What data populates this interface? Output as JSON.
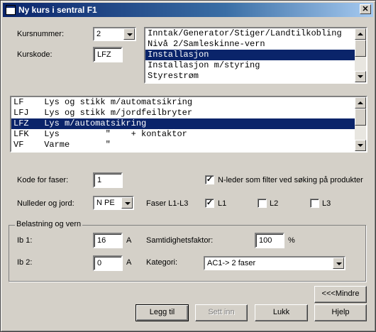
{
  "window": {
    "title": "Ny kurs i sentral  F1"
  },
  "kursnummer": {
    "label": "Kursnummer:",
    "value": "2"
  },
  "kurskode": {
    "label": "Kurskode:",
    "value": "LFZ"
  },
  "category_list": {
    "items": [
      "Inntak/Generator/Stiger/Landtilkobling",
      "Nivå 2/Samleskinne-vern",
      "Installasjon",
      "Installasjon m/styring",
      "Styrestrøm"
    ],
    "selected_index": 2
  },
  "code_list": {
    "items": [
      "LF    Lys og stikk m/automatsikring",
      "LFJ   Lys og stikk m/jordfeilbryter",
      "LFZ   Lys m/automatsikring",
      "LFK   Lys         \"    + kontaktor",
      "VF    Varme       \""
    ],
    "selected_index": 2
  },
  "kode_faser": {
    "label": "Kode for faser:",
    "value": "1"
  },
  "nleder_filter": {
    "label": "N-leder som filter ved søking på produkter",
    "checked": true
  },
  "nulleder": {
    "label": "Nulleder og jord:",
    "value": "N PE"
  },
  "faser": {
    "label": "Faser L1-L3",
    "l1": {
      "label": "L1",
      "checked": true
    },
    "l2": {
      "label": "L2",
      "checked": false
    },
    "l3": {
      "label": "L3",
      "checked": false
    }
  },
  "belastning": {
    "legend": "Belastning og vern",
    "ib1": {
      "label": "Ib 1:",
      "value": "16",
      "unit": "A"
    },
    "ib2": {
      "label": "Ib 2:",
      "value": "0",
      "unit": "A"
    },
    "samtidighet": {
      "label": "Samtidighetsfaktor:",
      "value": "100",
      "unit": "%"
    },
    "kategori": {
      "label": "Kategori:",
      "value": "AC1-> 2 faser"
    }
  },
  "buttons": {
    "mindre": "<<<Mindre",
    "legg_til": "Legg til",
    "sett_inn": "Sett inn",
    "lukk": "Lukk",
    "hjelp": "Hjelp"
  }
}
